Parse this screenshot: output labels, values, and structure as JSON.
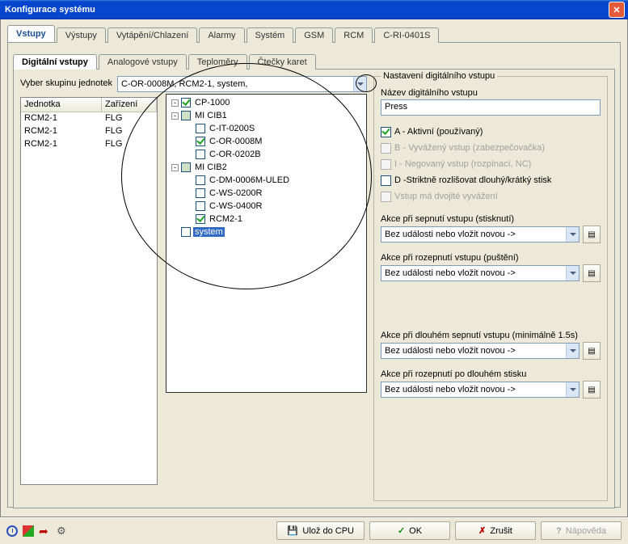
{
  "window": {
    "title": "Konfigurace systému"
  },
  "tabs": {
    "main": [
      "Vstupy",
      "Výstupy",
      "Vytápění/Chlazení",
      "Alarmy",
      "Systém",
      "GSM",
      "RCM",
      "C-RI-0401S"
    ],
    "main_active": 0,
    "sub": [
      "Digitální vstupy",
      "Analogové vstupy",
      "Teploměry",
      "Čtečky karet"
    ],
    "sub_active": 0
  },
  "unit_group": {
    "label": "Vyber skupinu jednotek",
    "value": "C-OR-0008M, RCM2-1, system,"
  },
  "units_table": {
    "cols": [
      "Jednotka",
      "Zařízení"
    ],
    "rows": [
      {
        "unit": "RCM2-1",
        "dev": "FLG"
      },
      {
        "unit": "RCM2-1",
        "dev": "FLG"
      },
      {
        "unit": "RCM2-1",
        "dev": "FLG"
      }
    ]
  },
  "tree": [
    {
      "indent": 0,
      "toggle": "-",
      "checked": true,
      "label": "CP-1000"
    },
    {
      "indent": 0,
      "toggle": "-",
      "checked": false,
      "box": "gray",
      "label": "MI CIB1"
    },
    {
      "indent": 1,
      "checked": false,
      "label": "C-IT-0200S"
    },
    {
      "indent": 1,
      "checked": true,
      "label": "C-OR-0008M"
    },
    {
      "indent": 1,
      "checked": false,
      "label": "C-OR-0202B"
    },
    {
      "indent": 0,
      "toggle": "-",
      "checked": false,
      "box": "gray",
      "label": "MI CIB2"
    },
    {
      "indent": 1,
      "checked": false,
      "label": "C-DM-0006M-ULED"
    },
    {
      "indent": 1,
      "checked": false,
      "label": "C-WS-0200R"
    },
    {
      "indent": 1,
      "checked": false,
      "label": "C-WS-0400R"
    },
    {
      "indent": 1,
      "checked": true,
      "label": "RCM2-1"
    },
    {
      "indent": 0,
      "checked": false,
      "label": "system",
      "selected": true
    }
  ],
  "right": {
    "group": "Nastavení digitálního vstupu",
    "name_label": "Název digitálního vstupu",
    "name_value": "Press",
    "checks": [
      {
        "label": "A - Aktivní (používaný)",
        "checked": true,
        "disabled": false
      },
      {
        "label": "B - Vyvážený vstup (zabezpečovačka)",
        "checked": false,
        "disabled": true
      },
      {
        "label": "I - Negovaný vstup (rozpínací, NC)",
        "checked": false,
        "disabled": true
      },
      {
        "label": "D -Striktně rozlišovat dlouhý/krátký stisk",
        "checked": false,
        "disabled": false
      },
      {
        "label": "Vstup má dvojité vyvážení",
        "checked": false,
        "disabled": true
      }
    ],
    "actions": [
      {
        "label": "Akce při sepnutí vstupu (stisknutí)",
        "value": "Bez události nebo vložit novou ->"
      },
      {
        "label": "Akce při rozepnutí vstupu (puštění)",
        "value": "Bez události nebo vložit novou ->"
      },
      {
        "label": "Akce při dlouhém sepnutí vstupu (minimálně 1.5s)",
        "value": "Bez události nebo vložit novou ->"
      },
      {
        "label": "Akce při rozepnutí po dlouhém stisku",
        "value": "Bez události nebo vložit novou ->"
      }
    ]
  },
  "buttons": {
    "save": "Ulož do CPU",
    "ok": "OK",
    "cancel": "Zrušit",
    "help": "Nápověda"
  }
}
